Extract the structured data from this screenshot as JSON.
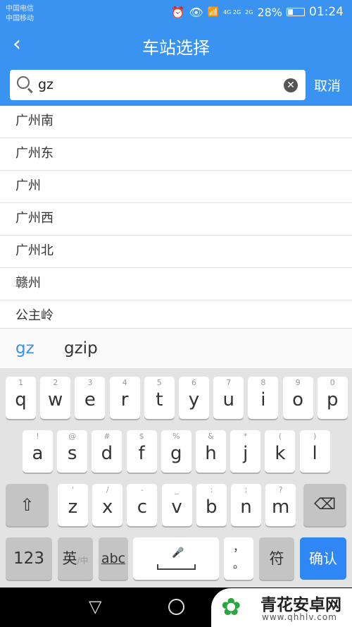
{
  "status": {
    "carrier1": "中国电信",
    "carrier2": "中国移动",
    "net1": "4G 2G",
    "net2": "2G",
    "battery": "28%",
    "battery_level": 0.28,
    "time": "01:24"
  },
  "header": {
    "title": "车站选择",
    "back_icon": "chevron-left-icon"
  },
  "search": {
    "value": "gz",
    "cancel": "取消"
  },
  "stations": [
    "广州南",
    "广州东",
    "广州",
    "广州西",
    "广州北",
    "赣州",
    "公主岭"
  ],
  "suggestions": [
    "gz",
    "gzip"
  ],
  "keyboard": {
    "row1": [
      [
        "q",
        "1"
      ],
      [
        "w",
        "2"
      ],
      [
        "e",
        "3"
      ],
      [
        "r",
        "4"
      ],
      [
        "t",
        "5"
      ],
      [
        "y",
        "6"
      ],
      [
        "u",
        "7"
      ],
      [
        "i",
        "8"
      ],
      [
        "o",
        "9"
      ],
      [
        "p",
        "0"
      ]
    ],
    "row2": [
      [
        "a",
        "!"
      ],
      [
        "s",
        "@"
      ],
      [
        "d",
        "#"
      ],
      [
        "f",
        "$"
      ],
      [
        "g",
        "%"
      ],
      [
        "h",
        "&"
      ],
      [
        "j",
        "*"
      ],
      [
        "k",
        "("
      ],
      [
        "l",
        ")"
      ]
    ],
    "row3": [
      [
        "z",
        "'"
      ],
      [
        "x",
        "/"
      ],
      [
        "c",
        "-"
      ],
      [
        "v",
        "_"
      ],
      [
        "b",
        ":"
      ],
      [
        "n",
        ";"
      ],
      [
        "m",
        "?"
      ]
    ],
    "num": "123",
    "lang": "英",
    "lang_sub": "/中",
    "abc": "abc",
    "punct_top": "，",
    "punct_bottom": "。",
    "symbols": "符",
    "confirm": "确认"
  },
  "watermark": {
    "name": "青花安卓网",
    "url": "www.qhhlv.com"
  },
  "colors": {
    "accent": "#3b93f1",
    "confirm": "#2f86f5"
  }
}
